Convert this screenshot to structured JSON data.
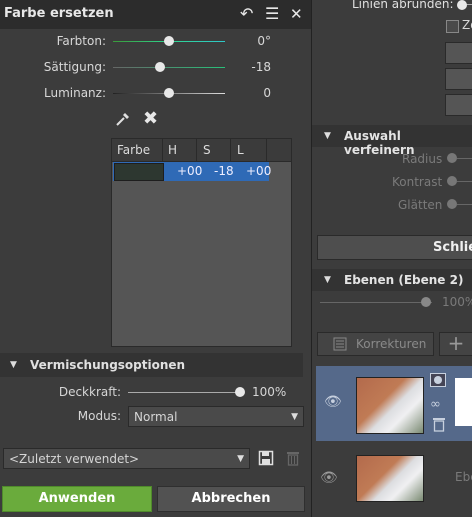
{
  "replace_color": {
    "title": "Farbe ersetzen",
    "sliders": [
      {
        "label": "Farbton:",
        "value": "0°",
        "level": 0.5
      },
      {
        "label": "Sättigung:",
        "value": "-18",
        "level": 0.41
      },
      {
        "label": "Luminanz:",
        "value": "0",
        "level": 0.5
      }
    ],
    "table": {
      "headers": [
        "Farbe",
        "H",
        "S",
        "L"
      ],
      "row": {
        "swatch": "#2d3730",
        "h": "+00",
        "s": "-18",
        "l": "+00"
      }
    },
    "blend_section": {
      "title": "Vermischungsoptionen",
      "opacity_label": "Deckkraft:",
      "opacity_value": "100%",
      "opacity_level": 1.0,
      "mode_label": "Modus:",
      "mode_value": "Normal"
    },
    "preset": "<Zuletzt verwendet>",
    "apply_label": "Anwenden",
    "cancel_label": "Abbrechen"
  },
  "right_panel": {
    "round_lines_label": "Linien abrunden:",
    "checkbox_label": "Zo",
    "refine_title": "Auswahl verfeinern",
    "refine_items": [
      "Radius",
      "Kontrast",
      "Glätten"
    ],
    "close_label": "Schlie",
    "layers_title": "Ebenen (Ebene 2)",
    "layers_opacity": "100%",
    "corrections_label": "Korrekturen",
    "layer2_name": "Ebe"
  },
  "colors": {
    "accent_green": "#6aab3c",
    "selection_blue": "#2f6ab6",
    "hue_track": "#2fd48f",
    "sat_track": "#29c07a"
  }
}
